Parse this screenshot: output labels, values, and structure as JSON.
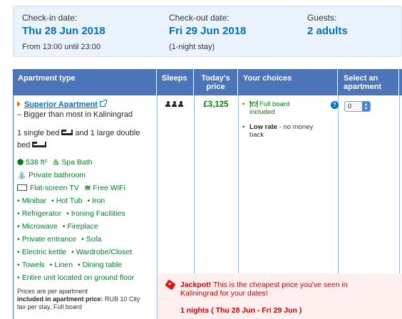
{
  "stay": {
    "checkin_label": "Check-in date:",
    "checkin_date": "Thu 28 Jun 2018",
    "checkin_time": "From 13:00 until 23:00",
    "checkout_label": "Check-out date:",
    "checkout_date": "Fri 29 Jun 2018",
    "checkout_note": "(1-night stay)",
    "guests_label": "Guests:",
    "guests_value": "2 adults"
  },
  "table": {
    "headers": {
      "type": "Apartment type",
      "sleeps": "Sleeps",
      "price_line1": "Today's",
      "price_line2": "price",
      "choices": "Your choices",
      "select_line1": "Select an",
      "select_line2": "apartment"
    }
  },
  "apartment": {
    "name": "Superior Apartment",
    "description": "– Bigger than most in Kaliningrad",
    "beds_text_1": "1 single bed",
    "beds_text_2": "and 1 large double",
    "beds_text_3": "bed",
    "sleeps_count": 3,
    "price": "£3,125",
    "facilities": {
      "size": "538 ft²",
      "spa": "Spa Bath",
      "bathroom": "Private bathroom",
      "tv": "Flat-screen TV",
      "wifi": "Free WiFi",
      "list": [
        [
          "Minibar",
          "Hot Tub",
          "Iron"
        ],
        [
          "Refrigerator",
          "Ironing Facilities"
        ],
        [
          "Microwave",
          "Fireplace"
        ],
        [
          "Private entrance",
          "Sofa"
        ],
        [
          "Electric kettle",
          "Wardrobe/Closet"
        ],
        [
          "Towels",
          "Linen",
          "Dining table"
        ],
        [
          "Entire unit located on ground floor"
        ]
      ]
    },
    "prices_note_1": "Prices are per apartment",
    "prices_note_2_bold": "included in apartment price:",
    "prices_note_2_rest": " RUB 10 City",
    "prices_note_3": "tax per stay, Full board"
  },
  "choices": {
    "meal_line1": "Full board",
    "meal_line2": "included",
    "help": "?",
    "rate_bold": "Low rate",
    "rate_rest": " - no money",
    "rate_line2": "back"
  },
  "select": {
    "value": "0"
  },
  "jackpot": {
    "title": "Jackpot!",
    "text": " This is the cheapest price you've seen in Kaliningrad for your dates!",
    "nights": "1 nights ( Thu 28 Jun - Fri 29 Jun )"
  },
  "colors": {
    "header_bg": "#4b75b8",
    "link": "#0071c2",
    "green": "#008009",
    "alert_red": "#cc0000",
    "summary_bg": "#ebf3ff"
  }
}
